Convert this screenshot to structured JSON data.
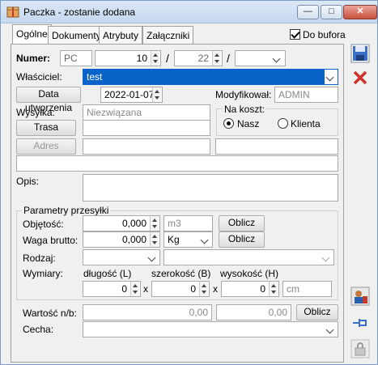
{
  "window": {
    "title": "Paczka - zostanie dodana",
    "min": "—",
    "max": "□",
    "close": "✕"
  },
  "tabs": [
    "Ogólne",
    "Dokumenty",
    "Atrybuty",
    "Załączniki"
  ],
  "to_buffer": {
    "label": "Do bufora",
    "checked": true
  },
  "numer": {
    "label": "Numer:",
    "prefix": "PC",
    "number": "10",
    "month": "22",
    "sep": "/"
  },
  "owner": {
    "label": "Właściciel:",
    "value": "test"
  },
  "creation": {
    "button": "Data utworzenia",
    "value": "2022-01-07"
  },
  "modified": {
    "label": "Modyfikował:",
    "value": "ADMIN"
  },
  "shipment": {
    "label": "Wysyłka:",
    "value": "Niezwiązana",
    "route_button": "Trasa",
    "address_button": "Adres"
  },
  "cost": {
    "label": "Na koszt:",
    "options": [
      "Nasz",
      "Klienta"
    ],
    "selected": "Nasz"
  },
  "description": {
    "label": "Opis:"
  },
  "params": {
    "title": "Parametry przesyłki",
    "volume": {
      "label": "Objętość:",
      "value": "0,000",
      "unit": "m3",
      "button": "Oblicz"
    },
    "weight": {
      "label": "Waga brutto:",
      "value": "0,000",
      "unit": "Kg",
      "button": "Oblicz"
    },
    "type": {
      "label": "Rodzaj:"
    },
    "dimensions": {
      "label": "Wymiary:",
      "length": "długość (L)",
      "width": "szerokość (B)",
      "height": "wysokość (H)",
      "l": "0",
      "b": "0",
      "h": "0",
      "x": "x",
      "unit": "cm"
    }
  },
  "value": {
    "label": "Wartość n/b:",
    "net": "0,00",
    "gross": "0,00",
    "button": "Oblicz"
  },
  "feature": {
    "label": "Cecha:"
  }
}
